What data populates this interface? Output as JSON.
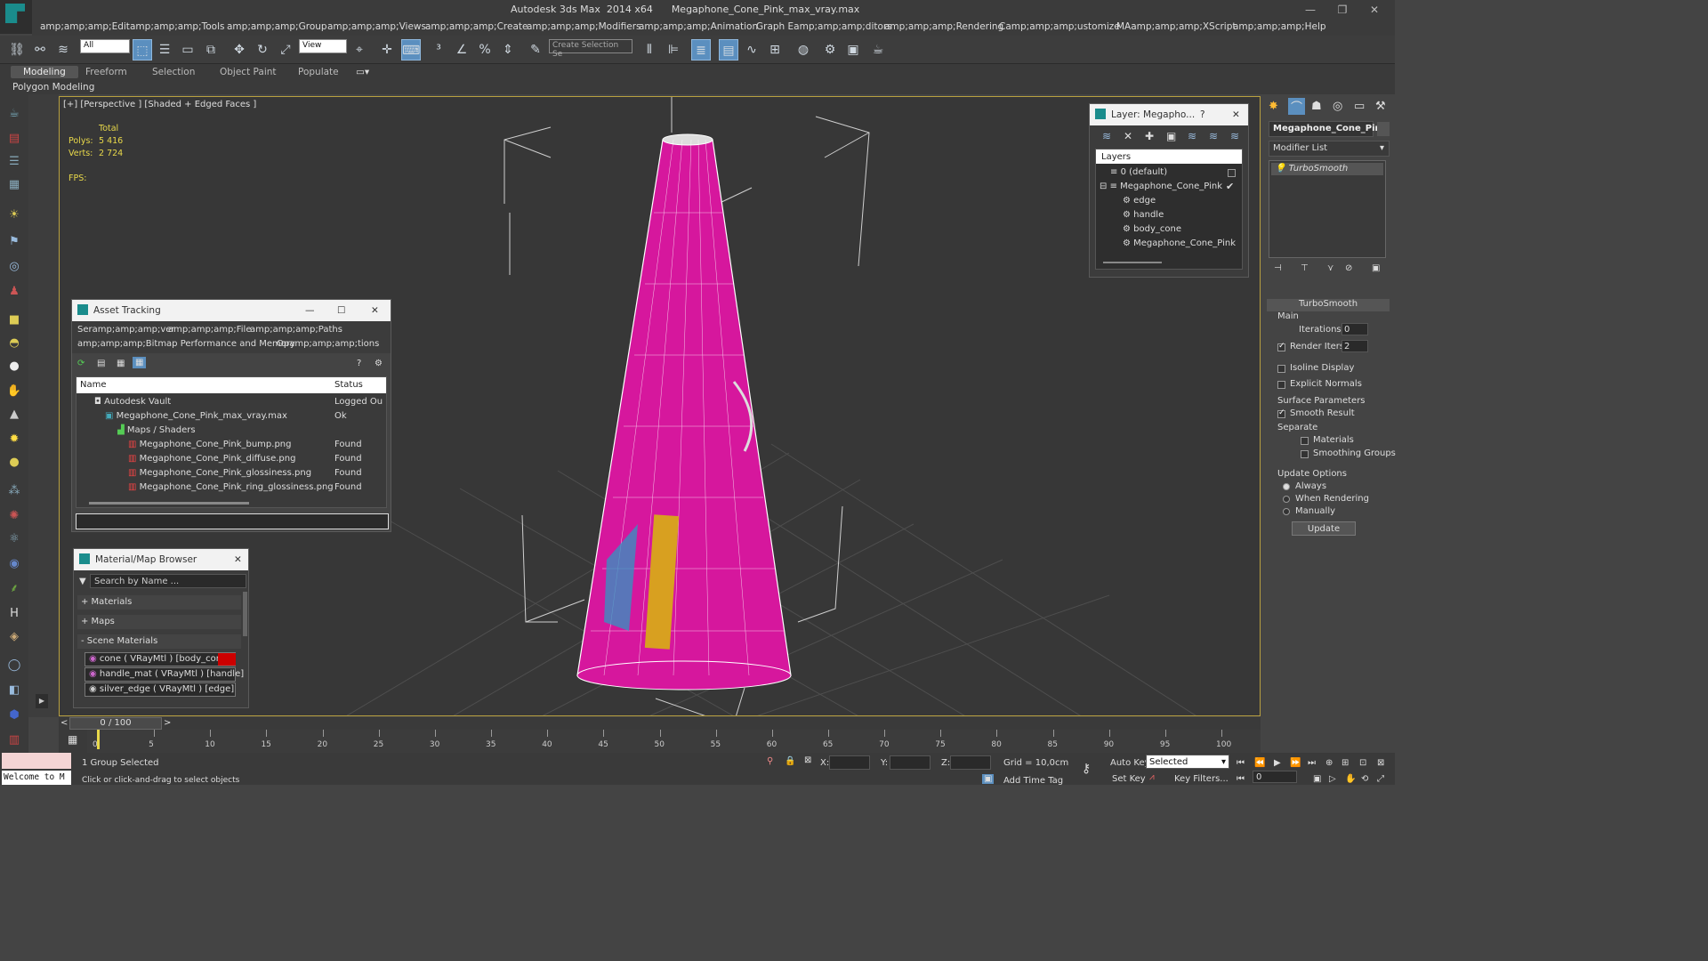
{
  "window": {
    "app": "Autodesk 3ds Max  2014 x64",
    "file": "Megaphone_Cone_Pink_max_vray.max"
  },
  "menu": [
    "amp;amp;amp;Edit",
    "amp;amp;amp;Tools",
    "amp;amp;amp;Group",
    "amp;amp;amp;Views",
    "amp;amp;amp;Create",
    "amp;amp;amp;Modifiers",
    "amp;amp;amp;Animation",
    "Graph Eamp;amp;amp;ditors",
    "amp;amp;amp;Rendering",
    "Camp;amp;amp;ustomize",
    "MAamp;amp;amp;XScript",
    "amp;amp;amp;Help"
  ],
  "toolbar": {
    "filter": "All",
    "coord": "View",
    "selection_set_placeholder": "Create Selection Se"
  },
  "ribbon": {
    "tabs": [
      "Modeling",
      "Freeform",
      "Selection",
      "Object Paint",
      "Populate"
    ],
    "active": "Modeling",
    "subpanel": "Polygon Modeling"
  },
  "viewport": {
    "label": "[+] [Perspective ] [Shaded + Edged Faces ]",
    "stats": {
      "total_label": "Total",
      "polys_label": "Polys:",
      "polys": "5 416",
      "verts_label": "Verts:",
      "verts": "2 724",
      "fps_label": "FPS:"
    },
    "colors": {
      "cone": "#d6179d",
      "grid": "#505050",
      "border": "#b8a040"
    }
  },
  "asset_tracking": {
    "title": "Asset Tracking",
    "menu_row1": [
      "Seramp;amp;amp;ver",
      "amp;amp;amp;File",
      "amp;amp;amp;Paths"
    ],
    "menu_row2": [
      "amp;amp;amp;Bitmap Performance and Memory",
      "Opamp;amp;amp;tions"
    ],
    "columns": [
      "Name",
      "Status"
    ],
    "rows": [
      {
        "name": "Autodesk Vault",
        "status": "Logged Ou"
      },
      {
        "name": "Megaphone_Cone_Pink_max_vray.max",
        "status": "Ok"
      },
      {
        "name": "Maps / Shaders",
        "status": ""
      },
      {
        "name": "Megaphone_Cone_Pink_bump.png",
        "status": "Found"
      },
      {
        "name": "Megaphone_Cone_Pink_diffuse.png",
        "status": "Found"
      },
      {
        "name": "Megaphone_Cone_Pink_glossiness.png",
        "status": "Found"
      },
      {
        "name": "Megaphone_Cone_Pink_ring_glossiness.png",
        "status": "Found"
      }
    ]
  },
  "material_browser": {
    "title": "Material/Map Browser",
    "search_placeholder": "Search by Name ...",
    "groups": [
      "+ Materials",
      "+ Maps",
      "- Scene Materials"
    ],
    "materials": [
      "cone ( VRayMtl ) [body_cone]",
      "handle_mat ( VRayMtl ) [handle]",
      "silver_edge ( VRayMtl ) [edge]"
    ]
  },
  "layer_dialog": {
    "title": "Layer: Megapho...",
    "help": "?",
    "header": "Layers",
    "items": [
      "0 (default)",
      "Megaphone_Cone_Pink",
      "edge",
      "handle",
      "body_cone",
      "Megaphone_Cone_Pink"
    ]
  },
  "command_panel": {
    "object_name": "Megaphone_Cone_Pink",
    "modifier_list": "Modifier List",
    "stack_item": "TurboSmooth",
    "rollout": "TurboSmooth",
    "main": "Main",
    "iterations_label": "Iterations:",
    "iterations": "0",
    "render_iters_label": "Render Iters:",
    "render_iters": "2",
    "isoline": "Isoline Display",
    "explicit": "Explicit Normals",
    "surface": "Surface Parameters",
    "smooth_result": "Smooth Result",
    "separate": "Separate",
    "materials": "Materials",
    "smoothing_groups": "Smoothing Groups",
    "update_options": "Update Options",
    "always": "Always",
    "when_rendering": "When Rendering",
    "manually": "Manually",
    "update_btn": "Update"
  },
  "timeline": {
    "frame": "0 / 100",
    "ticks": [
      "0",
      "5",
      "10",
      "15",
      "20",
      "25",
      "30",
      "35",
      "40",
      "45",
      "50",
      "55",
      "60",
      "65",
      "70",
      "75",
      "80",
      "85",
      "90",
      "95",
      "100"
    ]
  },
  "status": {
    "maxscript": "Welcome to M",
    "selected": "1 Group Selected",
    "prompt": "Click or click-and-drag to select objects",
    "x_label": "X:",
    "y_label": "Y:",
    "z_label": "Z:",
    "grid": "Grid = 10,0cm",
    "auto_key": "Auto Key",
    "set_key": "Set Key",
    "selected_drop": "Selected",
    "key_filters": "Key Filters...",
    "add_time_tag": "Add Time Tag",
    "frame_input": "0"
  }
}
